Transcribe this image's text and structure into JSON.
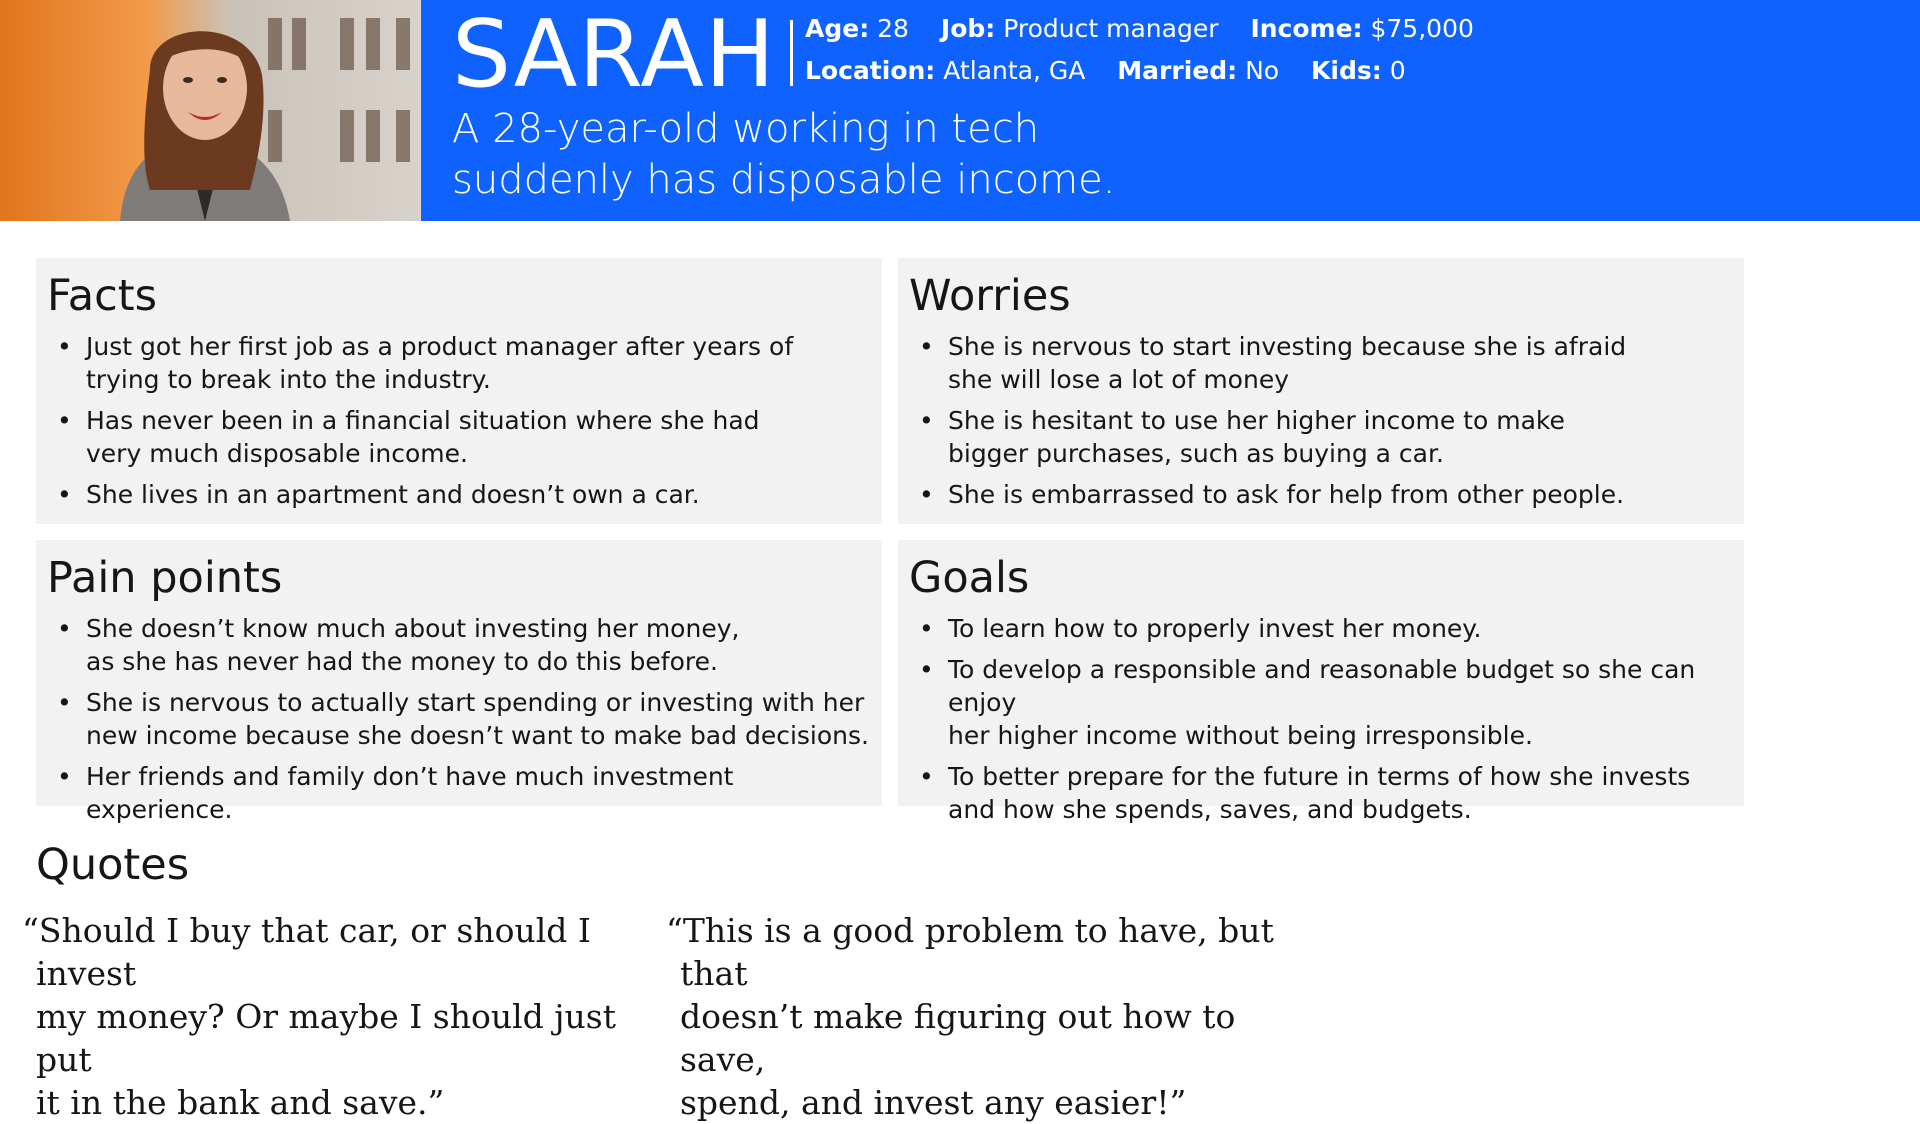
{
  "persona": {
    "name": "SARAH",
    "tagline": "A 28-year-old working in tech suddenly has disposable income.",
    "details_row1": [
      {
        "label": "Age:",
        "value": "28"
      },
      {
        "label": "Job:",
        "value": "Product manager"
      },
      {
        "label": "Income:",
        "value": "$75,000"
      }
    ],
    "details_row2": [
      {
        "label": "Location:",
        "value": "Atlanta, GA"
      },
      {
        "label": "Married:",
        "value": "No"
      },
      {
        "label": "Kids:",
        "value": "0"
      }
    ]
  },
  "sections": {
    "facts": {
      "title": "Facts",
      "items": [
        "Just got her first job as a product manager after years of\ntrying to break into the industry.",
        "Has never been in a financial situation where she had\nvery much disposable income.",
        "She lives in an apartment and doesn’t own a car."
      ]
    },
    "worries": {
      "title": "Worries",
      "items": [
        "She is nervous to start investing because she is afraid\nshe will lose a lot of money",
        "She is hesitant to use her higher income to make\nbigger purchases, such as buying a car.",
        "She is embarrassed to ask for help from other people."
      ]
    },
    "pain_points": {
      "title": "Pain points",
      "items": [
        "She doesn’t know much about investing her money,\nas she has never had the money to do this before.",
        "She is nervous to actually start spending or investing with her\nnew income because she doesn’t want to make bad decisions.",
        "Her friends and family don’t have much investment experience."
      ]
    },
    "goals": {
      "title": "Goals",
      "items": [
        "To learn how to properly invest her money.",
        "To develop a responsible and reasonable budget so she can enjoy\nher higher income without being irresponsible.",
        "To better prepare for the future in terms of how she invests\nand how she spends, saves, and budgets."
      ]
    }
  },
  "quotes": {
    "title": "Quotes",
    "items": [
      "“Should I buy that car, or should I invest\nmy money? Or maybe I should just put\nit in the bank and save.”",
      "“This is a good problem to have, but that\ndoesn’t make figuring out how to save,\nspend, and invest any easier!”"
    ]
  },
  "colors": {
    "header_blue": "#0f62fe",
    "card_gray": "#f2f2f2"
  }
}
